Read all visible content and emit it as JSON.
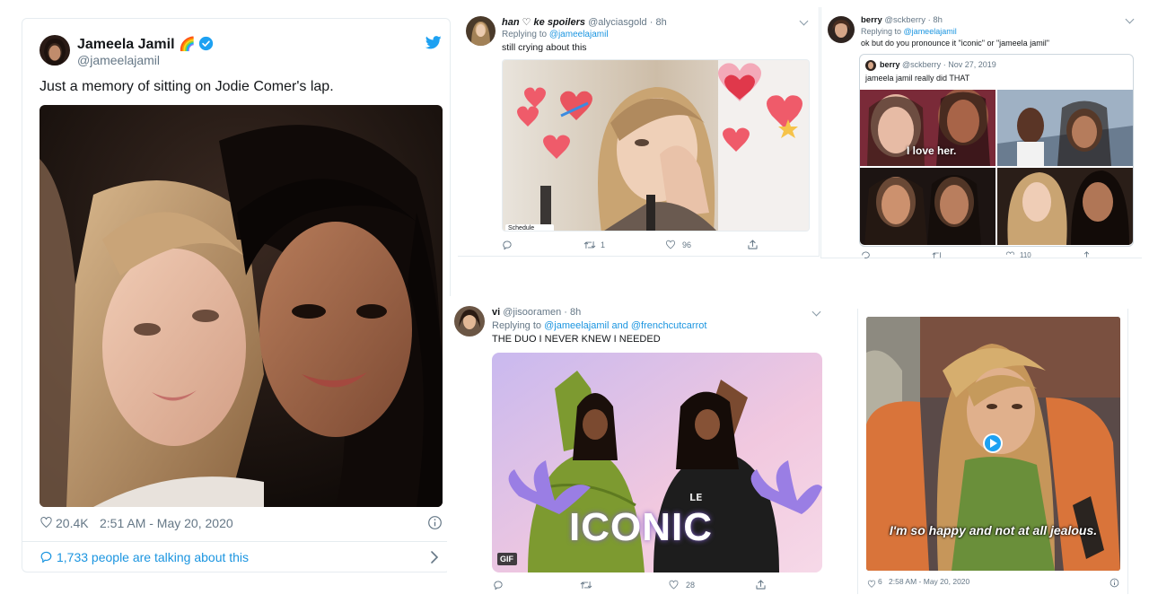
{
  "main_tweet": {
    "name": "Jameela Jamil",
    "name_emoji": "🌈",
    "handle": "@jameelajamil",
    "text": "Just a memory of sitting on Jodie Comer's lap.",
    "likes": "20.4K",
    "timestamp": "2:51 AM - May 20, 2020",
    "talking_about": "1,733 people are talking about this",
    "colors": {
      "verified": "#1da1f2",
      "link": "#1b95e0",
      "bird": "#1da1f2"
    }
  },
  "reply_han": {
    "name": "han ♡ ke spoilers",
    "handle": "@alyciasgold",
    "time": "· 8h",
    "replying_prefix": "Replying to",
    "replying_to": "@jameelajamil",
    "text": "still crying about this",
    "schedule_tag": "Schedule",
    "retweets": "1",
    "likes": "96"
  },
  "reply_berry": {
    "name": "berry",
    "handle": "@sckberry",
    "time": "· 8h",
    "replying_prefix": "Replying to",
    "replying_to": "@jameelajamil",
    "text": "ok but do you pronounce it \"iconic\" or \"jameela jamil\"",
    "quoted": {
      "name": "berry",
      "handle": "@sckberry",
      "date": "· Nov 27, 2019",
      "text": "jameela jamil really did THAT",
      "caption": "I love her."
    },
    "likes": "110"
  },
  "reply_vi": {
    "name": "vi",
    "handle": "@jisooramen",
    "time": "· 8h",
    "replying_prefix": "Replying to",
    "replying_to": "@jameelajamil and @frenchcutcarrot",
    "text": "THE DUO I NEVER KNEW I NEEDED",
    "gif_text": "ICONIC",
    "gif_badge": "GIF",
    "likes": "28"
  },
  "reply_friends": {
    "subtitle": "I'm so happy and not at all jealous.",
    "likes": "6",
    "timestamp": "2:58 AM - May 20, 2020"
  }
}
